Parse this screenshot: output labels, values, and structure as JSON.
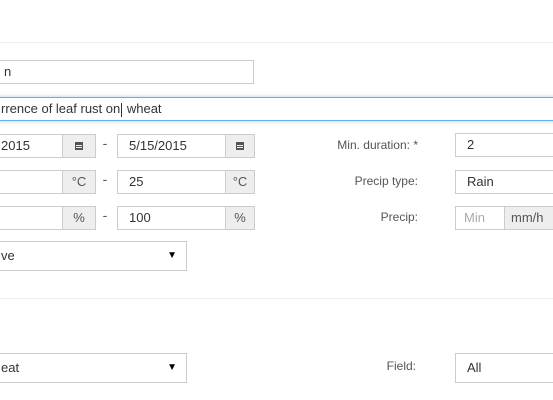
{
  "form": {
    "name_value": "n",
    "description_before_caret": "rrence of leaf rust on",
    "description_after_caret": " wheat",
    "date_start": "2015",
    "date_end": "5/15/2015",
    "date_icon": "calendar-icon",
    "temp_unit": "°C",
    "temp_max": "25",
    "humidity_unit": "%",
    "humidity_max": "100",
    "select1_value": "ve",
    "dash": "-",
    "min_duration_label": "Min. duration: *",
    "min_duration_value": "2",
    "precip_type_label": "Precip type:",
    "precip_type_value": "Rain",
    "precip_label": "Precip:",
    "precip_placeholder": "Min",
    "precip_unit": "mm/h",
    "crop_value": "eat",
    "field_label": "Field:",
    "field_value": "All",
    "select_arrow": "▼"
  }
}
